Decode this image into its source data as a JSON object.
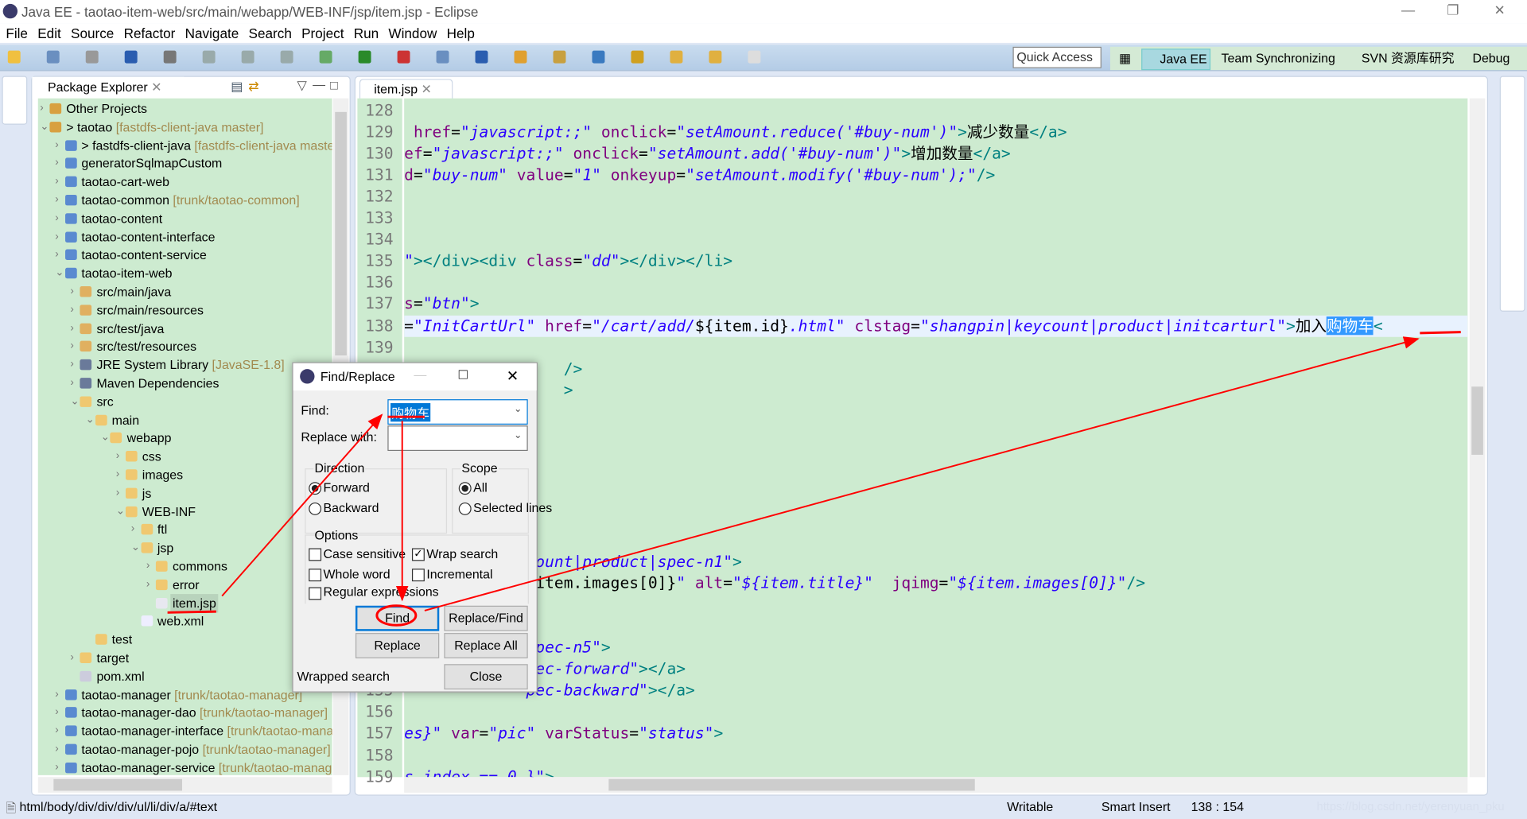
{
  "window": {
    "title": "Java EE - taotao-item-web/src/main/webapp/WEB-INF/jsp/item.jsp - Eclipse"
  },
  "menu": [
    "File",
    "Edit",
    "Source",
    "Refactor",
    "Navigate",
    "Search",
    "Project",
    "Run",
    "Window",
    "Help"
  ],
  "toolbar": {
    "quick_access_placeholder": "Quick Access"
  },
  "perspectives": [
    {
      "label": "Java EE",
      "selected": true
    },
    {
      "label": "Team Synchronizing"
    },
    {
      "label": "SVN 资源库研究"
    },
    {
      "label": "Debug"
    }
  ],
  "package_explorer": {
    "title": "Package Explorer",
    "items": [
      {
        "label": "Other Projects",
        "level": 0,
        "state": "collapsed",
        "icon": "working-set-icon"
      },
      {
        "label": "> taotao",
        "decoration": "[fastdfs-client-java master]",
        "level": 0,
        "state": "expanded",
        "icon": "working-set-icon"
      },
      {
        "label": "> fastdfs-client-java",
        "decoration": "[fastdfs-client-java master]",
        "level": 1,
        "state": "collapsed",
        "icon": "maven-project-icon"
      },
      {
        "label": "generatorSqlmapCustom",
        "level": 1,
        "state": "collapsed",
        "icon": "project-icon"
      },
      {
        "label": "taotao-cart-web",
        "level": 1,
        "state": "collapsed",
        "icon": "maven-project-icon"
      },
      {
        "label": "taotao-common",
        "decoration": "[trunk/taotao-common]",
        "level": 1,
        "state": "collapsed",
        "icon": "maven-project-icon"
      },
      {
        "label": "taotao-content",
        "level": 1,
        "state": "collapsed",
        "icon": "maven-project-icon"
      },
      {
        "label": "taotao-content-interface",
        "level": 1,
        "state": "collapsed",
        "icon": "maven-project-icon"
      },
      {
        "label": "taotao-content-service",
        "level": 1,
        "state": "collapsed",
        "icon": "maven-project-icon"
      },
      {
        "label": "taotao-item-web",
        "level": 1,
        "state": "expanded",
        "icon": "maven-project-icon"
      },
      {
        "label": "src/main/java",
        "level": 2,
        "state": "collapsed",
        "icon": "source-folder-icon"
      },
      {
        "label": "src/main/resources",
        "level": 2,
        "state": "collapsed",
        "icon": "source-folder-icon"
      },
      {
        "label": "src/test/java",
        "level": 2,
        "state": "collapsed",
        "icon": "source-folder-icon"
      },
      {
        "label": "src/test/resources",
        "level": 2,
        "state": "collapsed",
        "icon": "source-folder-icon"
      },
      {
        "label": "JRE System Library",
        "decoration": "[JavaSE-1.8]",
        "level": 2,
        "state": "collapsed",
        "icon": "library-icon"
      },
      {
        "label": "Maven Dependencies",
        "level": 2,
        "state": "collapsed",
        "icon": "library-icon"
      },
      {
        "label": "src",
        "level": 2,
        "state": "expanded",
        "icon": "folder-icon"
      },
      {
        "label": "main",
        "level": 3,
        "state": "expanded",
        "icon": "folder-icon"
      },
      {
        "label": "webapp",
        "level": 4,
        "state": "expanded",
        "icon": "folder-icon"
      },
      {
        "label": "css",
        "level": 5,
        "state": "collapsed",
        "icon": "folder-icon"
      },
      {
        "label": "images",
        "level": 5,
        "state": "collapsed",
        "icon": "folder-icon"
      },
      {
        "label": "js",
        "level": 5,
        "state": "collapsed",
        "icon": "folder-icon"
      },
      {
        "label": "WEB-INF",
        "level": 5,
        "state": "expanded",
        "icon": "folder-icon"
      },
      {
        "label": "ftl",
        "level": 6,
        "state": "collapsed",
        "icon": "folder-icon"
      },
      {
        "label": "jsp",
        "level": 6,
        "state": "expanded",
        "icon": "folder-icon"
      },
      {
        "label": "commons",
        "level": 7,
        "state": "collapsed",
        "icon": "folder-icon"
      },
      {
        "label": "error",
        "level": 7,
        "state": "collapsed",
        "icon": "folder-icon"
      },
      {
        "label": "item.jsp",
        "level": 7,
        "state": "leaf",
        "icon": "jsp-file-icon",
        "selected": true
      },
      {
        "label": "web.xml",
        "level": 6,
        "state": "leaf",
        "icon": "xml-file-icon"
      },
      {
        "label": "test",
        "level": 3,
        "state": "leaf",
        "icon": "folder-icon"
      },
      {
        "label": "target",
        "level": 2,
        "state": "collapsed",
        "icon": "folder-icon"
      },
      {
        "label": "pom.xml",
        "level": 2,
        "state": "leaf",
        "icon": "maven-pom-icon"
      },
      {
        "label": "taotao-manager",
        "decoration": "[trunk/taotao-manager]",
        "level": 1,
        "state": "collapsed",
        "icon": "maven-project-icon"
      },
      {
        "label": "taotao-manager-dao",
        "decoration": "[trunk/taotao-manager]",
        "level": 1,
        "state": "collapsed",
        "icon": "maven-project-icon"
      },
      {
        "label": "taotao-manager-interface",
        "decoration": "[trunk/taotao-manager]",
        "level": 1,
        "state": "collapsed",
        "icon": "maven-project-icon"
      },
      {
        "label": "taotao-manager-pojo",
        "decoration": "[trunk/taotao-manager]",
        "level": 1,
        "state": "collapsed",
        "icon": "maven-project-icon"
      },
      {
        "label": "taotao-manager-service",
        "decoration": "[trunk/taotao-manager]",
        "level": 1,
        "state": "collapsed",
        "icon": "maven-project-icon"
      }
    ]
  },
  "editor": {
    "tab": "item.jsp",
    "current_line": 138,
    "lines": [
      {
        "n": 128,
        "segs": []
      },
      {
        "n": 129,
        "segs": [
          [
            " href",
            "a"
          ],
          [
            "=",
            "p"
          ],
          [
            "\"javascript:;\"",
            "v"
          ],
          [
            " onclick",
            "a"
          ],
          [
            "=",
            "p"
          ],
          [
            "\"setAmount.reduce('#buy-num')\"",
            "v"
          ],
          [
            ">",
            "t"
          ],
          [
            "减少数量",
            "p"
          ],
          [
            "</a>",
            "t"
          ]
        ]
      },
      {
        "n": 130,
        "segs": [
          [
            "ef",
            "a"
          ],
          [
            "=",
            "p"
          ],
          [
            "\"javascript:;\"",
            "v"
          ],
          [
            " onclick",
            "a"
          ],
          [
            "=",
            "p"
          ],
          [
            "\"setAmount.add('#buy-num')\"",
            "v"
          ],
          [
            ">",
            "t"
          ],
          [
            "增加数量",
            "p"
          ],
          [
            "</a>",
            "t"
          ]
        ]
      },
      {
        "n": 131,
        "segs": [
          [
            "d",
            "a"
          ],
          [
            "=",
            "p"
          ],
          [
            "\"buy-num\"",
            "v"
          ],
          [
            " value",
            "a"
          ],
          [
            "=",
            "p"
          ],
          [
            "\"1\"",
            "v"
          ],
          [
            " onkeyup",
            "a"
          ],
          [
            "=",
            "p"
          ],
          [
            "\"setAmount.modify('#buy-num');\"",
            "v"
          ],
          [
            "/>",
            "t"
          ]
        ]
      },
      {
        "n": 132,
        "segs": []
      },
      {
        "n": 133,
        "segs": []
      },
      {
        "n": 134,
        "segs": []
      },
      {
        "n": 135,
        "segs": [
          [
            "\"",
            "v"
          ],
          [
            "></div><div",
            "t"
          ],
          [
            " class",
            "a"
          ],
          [
            "=",
            "p"
          ],
          [
            "\"dd\"",
            "v"
          ],
          [
            "></div></li>",
            "t"
          ]
        ]
      },
      {
        "n": 136,
        "segs": []
      },
      {
        "n": 137,
        "segs": [
          [
            "s",
            "a"
          ],
          [
            "=",
            "p"
          ],
          [
            "\"btn\"",
            "v"
          ],
          [
            ">",
            "t"
          ]
        ]
      },
      {
        "n": 138,
        "segs": [
          [
            "=",
            "p"
          ],
          [
            "\"InitCartUrl\"",
            "v"
          ],
          [
            " href",
            "a"
          ],
          [
            "=",
            "p"
          ],
          [
            "\"/cart/add/",
            "v"
          ],
          [
            "${item.id}",
            "p"
          ],
          [
            ".html\"",
            "v"
          ],
          [
            " clstag",
            "a"
          ],
          [
            "=",
            "p"
          ],
          [
            "\"shangpin|keycount|product|initcarturl\"",
            "v"
          ],
          [
            ">",
            "t"
          ],
          [
            "加入",
            "p"
          ],
          [
            "购物车",
            "sel"
          ],
          [
            "<",
            "t"
          ]
        ]
      },
      {
        "n": 139,
        "segs": []
      },
      {
        "n": 140,
        "segs": [
          [
            "                 ",
            "p"
          ],
          [
            "/>",
            "t"
          ]
        ]
      },
      {
        "n": 141,
        "segs": [
          [
            "                 ",
            "p"
          ],
          [
            ">",
            "t"
          ]
        ]
      },
      {
        "n": 142,
        "segs": []
      },
      {
        "n": 143,
        "segs": []
      },
      {
        "n": 144,
        "segs": []
      },
      {
        "n": 145,
        "segs": []
      },
      {
        "n": 146,
        "segs": []
      },
      {
        "n": 147,
        "segs": []
      },
      {
        "n": 148,
        "segs": []
      },
      {
        "n": 149,
        "segs": [
          [
            "             ",
            "p"
          ],
          [
            "count|product|spec-n1\"",
            "v"
          ],
          [
            ">",
            "t"
          ]
        ]
      },
      {
        "n": 150,
        "segs": [
          [
            "             ",
            "p"
          ],
          [
            "[item.images[0]}",
            "p"
          ],
          [
            "\"",
            "v"
          ],
          [
            " alt",
            "a"
          ],
          [
            "=",
            "p"
          ],
          [
            "\"${item.title}\"",
            "v"
          ],
          [
            "  jqimg",
            "a"
          ],
          [
            "=",
            "p"
          ],
          [
            "\"${item.images[0]}\"",
            "v"
          ],
          [
            "/>",
            "t"
          ]
        ]
      },
      {
        "n": 151,
        "segs": []
      },
      {
        "n": 152,
        "segs": []
      },
      {
        "n": 153,
        "segs": [
          [
            "             ",
            "p"
          ],
          [
            "spec-n5\"",
            "v"
          ],
          [
            ">",
            "t"
          ]
        ]
      },
      {
        "n": 154,
        "segs": [
          [
            "             ",
            "p"
          ],
          [
            "pec-forward\"",
            "v"
          ],
          [
            "></a>",
            "t"
          ]
        ]
      },
      {
        "n": 155,
        "segs": [
          [
            "             ",
            "p"
          ],
          [
            "pec-backward\"",
            "v"
          ],
          [
            "></a>",
            "t"
          ]
        ]
      },
      {
        "n": 156,
        "segs": []
      },
      {
        "n": 157,
        "segs": [
          [
            "es}\"",
            "v"
          ],
          [
            " var",
            "a"
          ],
          [
            "=",
            "p"
          ],
          [
            "\"pic\"",
            "v"
          ],
          [
            " varStatus",
            "a"
          ],
          [
            "=",
            "p"
          ],
          [
            "\"status\"",
            "v"
          ],
          [
            ">",
            "t"
          ]
        ]
      },
      {
        "n": 158,
        "segs": []
      },
      {
        "n": 159,
        "segs": [
          [
            "s.index == 0 }\"",
            "v"
          ],
          [
            ">",
            "t"
          ]
        ]
      }
    ]
  },
  "find_replace": {
    "title": "Find/Replace",
    "find_label": "Find:",
    "find_value": "购物车",
    "replace_label": "Replace with:",
    "replace_value": "",
    "direction": {
      "label": "Direction",
      "options": [
        "Forward",
        "Backward"
      ],
      "selected": "Forward"
    },
    "scope": {
      "label": "Scope",
      "options": [
        "All",
        "Selected lines"
      ],
      "selected": "All"
    },
    "options": {
      "label": "Options",
      "case_sensitive": {
        "label": "Case sensitive",
        "checked": false
      },
      "wrap_search": {
        "label": "Wrap search",
        "checked": true
      },
      "whole_word": {
        "label": "Whole word",
        "checked": false
      },
      "incremental": {
        "label": "Incremental",
        "checked": false
      },
      "regex": {
        "label": "Regular expressions",
        "checked": false
      }
    },
    "buttons": {
      "find": "Find",
      "replace_find": "Replace/Find",
      "replace": "Replace",
      "replace_all": "Replace All",
      "close": "Close"
    },
    "status": "Wrapped search"
  },
  "statusbar": {
    "path": "html/body/div/div/div/ul/li/div/a/#text",
    "writable": "Writable",
    "insert_mode": "Smart Insert",
    "position": "138 : 154",
    "watermark": "https://blog.csdn.net/yerenyuan_pku"
  },
  "colors": {
    "editor_bg": "#cdebd0",
    "annotation": "#ff0000",
    "selection": "#3399ff"
  }
}
